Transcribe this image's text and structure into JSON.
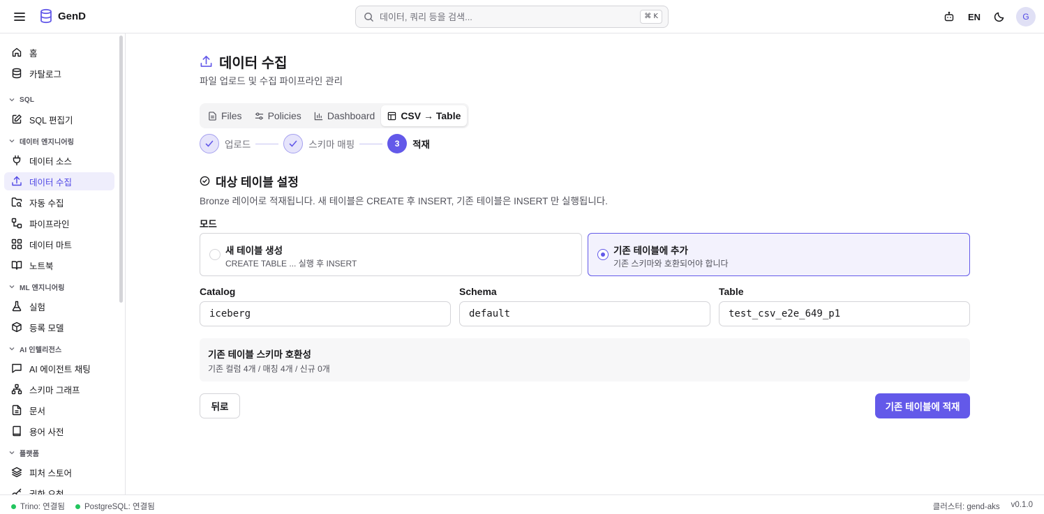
{
  "app": {
    "name": "GenD"
  },
  "search": {
    "placeholder": "데이터, 쿼리 등을 검색...",
    "shortcut": "⌘ K"
  },
  "header": {
    "language": "EN",
    "avatar_initial": "G"
  },
  "sidebar": {
    "items": [
      {
        "label": "홈",
        "icon": "home-icon"
      },
      {
        "label": "카탈로그",
        "icon": "database-icon"
      }
    ],
    "sections": [
      {
        "label": "SQL",
        "items": [
          {
            "label": "SQL 편집기",
            "icon": "edit-icon"
          }
        ]
      },
      {
        "label": "데이터 엔지니어링",
        "items": [
          {
            "label": "데이터 소스",
            "icon": "plug-icon"
          },
          {
            "label": "데이터 수집",
            "icon": "upload-icon",
            "active": true
          },
          {
            "label": "자동 수집",
            "icon": "folder-search-icon"
          },
          {
            "label": "파이프라인",
            "icon": "workflow-icon"
          },
          {
            "label": "데이터 마트",
            "icon": "grid-icon"
          },
          {
            "label": "노트북",
            "icon": "book-icon"
          }
        ]
      },
      {
        "label": "ML 엔지니어링",
        "items": [
          {
            "label": "실험",
            "icon": "flask-icon"
          },
          {
            "label": "등록 모델",
            "icon": "box-icon"
          }
        ]
      },
      {
        "label": "AI 인텔리전스",
        "items": [
          {
            "label": "AI 에이전트 채팅",
            "icon": "chat-icon"
          },
          {
            "label": "스키마 그래프",
            "icon": "network-icon"
          },
          {
            "label": "문서",
            "icon": "file-icon"
          },
          {
            "label": "용어 사전",
            "icon": "dictionary-icon"
          }
        ]
      },
      {
        "label": "플랫폼",
        "items": [
          {
            "label": "피처 스토어",
            "icon": "layers-icon"
          },
          {
            "label": "권한 요청",
            "icon": "key-icon"
          }
        ]
      }
    ]
  },
  "page": {
    "title": "데이터 수집",
    "subtitle": "파일 업로드 및 수집 파이프라인 관리",
    "tabs": [
      {
        "label": "Files",
        "icon": "file-text-icon"
      },
      {
        "label": "Policies",
        "icon": "sliders-icon"
      },
      {
        "label": "Dashboard",
        "icon": "bar-chart-icon"
      },
      {
        "label": "CSV → Table",
        "icon": "table-icon",
        "active": true
      }
    ],
    "steps": [
      {
        "label": "업로드",
        "status": "done"
      },
      {
        "label": "스키마 매핑",
        "status": "done"
      },
      {
        "number": "3",
        "label": "적재",
        "status": "current"
      }
    ],
    "section": {
      "title": "대상 테이블 설정",
      "description": "Bronze 레이어로 적재됩니다. 새 테이블은 CREATE 후 INSERT, 기존 테이블은 INSERT 만 실행됩니다."
    },
    "mode": {
      "label": "모드",
      "options": [
        {
          "title": "새 테이블 생성",
          "description": "CREATE TABLE ... 실행 후 INSERT",
          "selected": false
        },
        {
          "title": "기존 테이블에 추가",
          "description": "기존 스키마와 호환되어야 합니다",
          "selected": true
        }
      ]
    },
    "fields": {
      "catalog": {
        "label": "Catalog",
        "value": "iceberg"
      },
      "schema": {
        "label": "Schema",
        "value": "default"
      },
      "table": {
        "label": "Table",
        "value": "test_csv_e2e_649_p1"
      }
    },
    "compat": {
      "title": "기존 테이블 스키마 호환성",
      "description": "기존 컬럼 4개 / 매칭 4개 / 신규 0개"
    },
    "buttons": {
      "back": "뒤로",
      "submit": "기존 테이블에 적재"
    }
  },
  "status": {
    "trino": "Trino: 연결됨",
    "postgres": "PostgreSQL: 연결됨",
    "cluster": "클러스터: gend-aks",
    "version": "v0.1.0"
  },
  "colors": {
    "accent": "#6359e9",
    "status_ok": "#22c55e"
  }
}
